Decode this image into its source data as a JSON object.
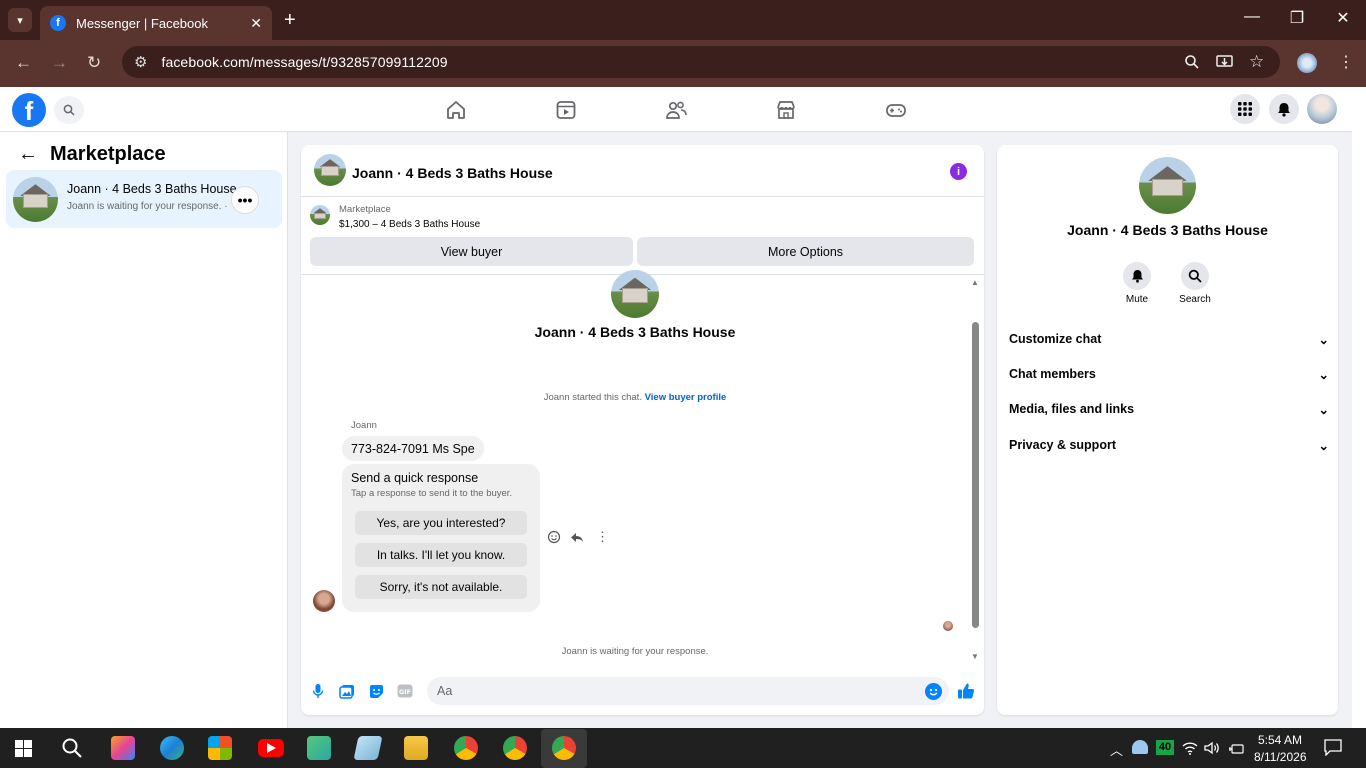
{
  "browser": {
    "tab_title": "Messenger | Facebook",
    "tab_close": "✕",
    "new_tab": "+",
    "url": "facebook.com/messages/t/932857099112209",
    "window": {
      "minimize": "—",
      "restore": "❐",
      "close": "✕"
    },
    "nav": {
      "back": "←",
      "forward": "→",
      "reload": "↻"
    }
  },
  "facebook_header": {
    "logo": "f",
    "nav_icons": [
      "home-icon",
      "video-icon",
      "friends-icon",
      "marketplace-icon",
      "gaming-icon"
    ]
  },
  "left_panel": {
    "title": "Marketplace",
    "back_arrow": "←",
    "conversation": {
      "name": "Joann · 4 Beds 3 Baths House",
      "preview": "Joann is waiting for your response. ·",
      "more": "•••"
    }
  },
  "chat": {
    "header_name": "Joann · 4 Beds 3 Baths House",
    "info_icon": "i",
    "listing": {
      "label": "Marketplace",
      "price_title": "$1,300 – 4 Beds 3 Baths House"
    },
    "buttons": {
      "view_buyer": "View buyer",
      "more_options": "More Options"
    },
    "intro_name": "Joann · 4 Beds 3 Baths House",
    "started_text": "Joann started this chat.",
    "started_link": "View buyer profile",
    "sender": "Joann",
    "message": "773-824-7091 Ms Spe",
    "quick_response": {
      "title": "Send a quick response",
      "subtitle": "Tap a response to send it to the buyer.",
      "options": [
        "Yes, are you interested?",
        "In talks. I'll let you know.",
        "Sorry, it's not available."
      ]
    },
    "waiting": "Joann is waiting for your response.",
    "composer": {
      "placeholder": "Aa"
    }
  },
  "info_panel": {
    "name": "Joann · 4 Beds 3 Baths House",
    "actions": [
      {
        "label": "Mute",
        "icon": "bell-icon"
      },
      {
        "label": "Search",
        "icon": "search-icon"
      }
    ],
    "sections": [
      "Customize chat",
      "Chat members",
      "Media, files and links",
      "Privacy & support"
    ]
  },
  "taskbar": {
    "time": "5:54 AM",
    "date": "8/11/2026",
    "badge": "40"
  },
  "colors": {
    "brand": "#1877f2",
    "messenger": "#0084ff",
    "chrome_dark": "#3b1f1c",
    "chrome": "#5a3530"
  }
}
